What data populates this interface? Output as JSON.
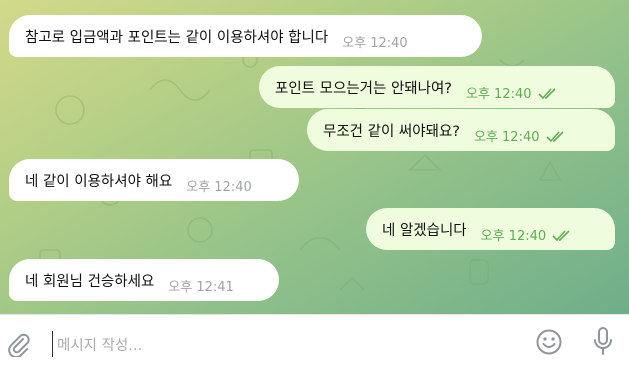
{
  "messages": [
    {
      "direction": "in",
      "text": "참고로 입금액과 포인트는 같이 이용하셔야 합니다",
      "time": "오후 12:40"
    },
    {
      "direction": "out",
      "text": "포인트 모으는거는 안돼나여?",
      "time": "오후 12:40",
      "status": "read"
    },
    {
      "direction": "out",
      "text": "무조건 같이 써야돼요?",
      "time": "오후 12:40",
      "status": "read"
    },
    {
      "direction": "in",
      "text": "네 같이 이용하셔야 해요",
      "time": "오후 12:40"
    },
    {
      "direction": "out",
      "text": "네 알겠습니다",
      "time": "오후 12:40",
      "status": "read"
    },
    {
      "direction": "in",
      "text": "네 회원님 건승하세요",
      "time": "오후 12:41"
    }
  ],
  "composer": {
    "placeholder": "메시지 작성...",
    "icons": {
      "attach": "paperclip-icon",
      "emoji": "smiley-icon",
      "voice": "microphone-icon"
    }
  },
  "colors": {
    "incoming_bubble": "#ffffff",
    "outgoing_bubble": "#effdde",
    "outgoing_meta": "#62ac55",
    "incoming_meta": "#9fa3a8",
    "wallpaper_light": "#d3d98a",
    "wallpaper_dark": "#6fae8a"
  }
}
